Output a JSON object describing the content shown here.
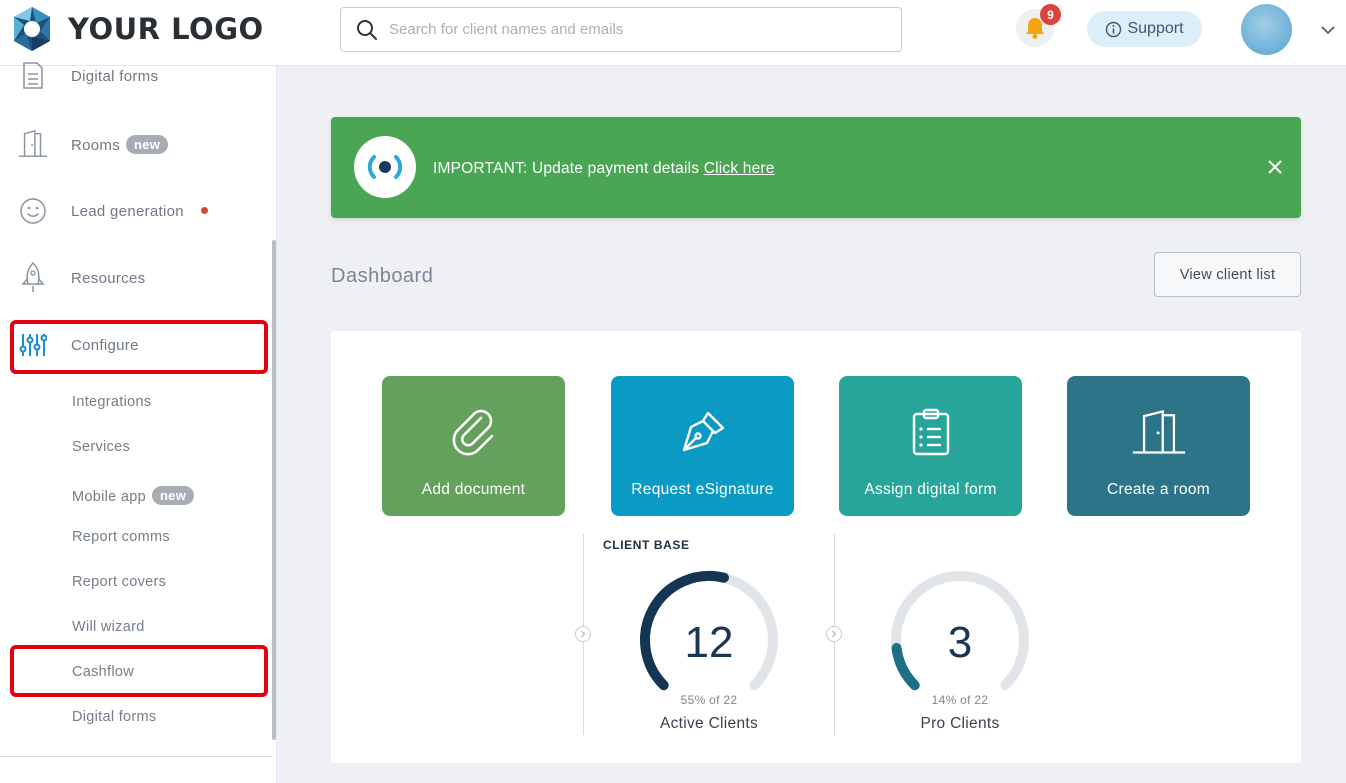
{
  "header": {
    "logo_text": "YOUR LOGO",
    "search_placeholder": "Search for client names and emails",
    "notification_count": "9",
    "support_label": "Support"
  },
  "sidebar": {
    "items": [
      {
        "label": "Digital forms",
        "icon": "document-icon"
      },
      {
        "label": "Rooms",
        "badge": "new",
        "icon": "door-icon"
      },
      {
        "label": "Lead generation",
        "icon": "smiley-icon"
      },
      {
        "label": "Resources",
        "icon": "rocket-icon"
      },
      {
        "label": "Configure",
        "icon": "sliders-icon"
      }
    ],
    "sub_items": [
      {
        "label": "Integrations"
      },
      {
        "label": "Services"
      },
      {
        "label": "Mobile app",
        "badge": "new"
      },
      {
        "label": "Report comms"
      },
      {
        "label": "Report covers"
      },
      {
        "label": "Will wizard"
      },
      {
        "label": "Cashflow"
      },
      {
        "label": "Digital forms"
      }
    ]
  },
  "banner": {
    "text": "IMPORTANT: Update payment details",
    "link": "Click here"
  },
  "dashboard": {
    "title": "Dashboard",
    "view_client_list": "View client list",
    "tiles": [
      {
        "label": "Add document",
        "color": "#63a15d",
        "icon": "paperclip-icon"
      },
      {
        "label": "Request eSignature",
        "color": "#0b9ac4",
        "icon": "pen-nib-icon"
      },
      {
        "label": "Assign digital form",
        "color": "#27a59b",
        "icon": "clipboard-icon"
      },
      {
        "label": "Create a room",
        "color": "#2e7489",
        "icon": "door-icon"
      }
    ],
    "client_base_label": "CLIENT BASE",
    "gauges": [
      {
        "value": "12",
        "fraction": 0.55,
        "subtitle": "55% of 22",
        "label": "Active Clients",
        "color": "#143553"
      },
      {
        "value": "3",
        "fraction": 0.14,
        "subtitle": "14% of 22",
        "label": "Pro Clients",
        "color": "#1d6f86"
      }
    ]
  }
}
